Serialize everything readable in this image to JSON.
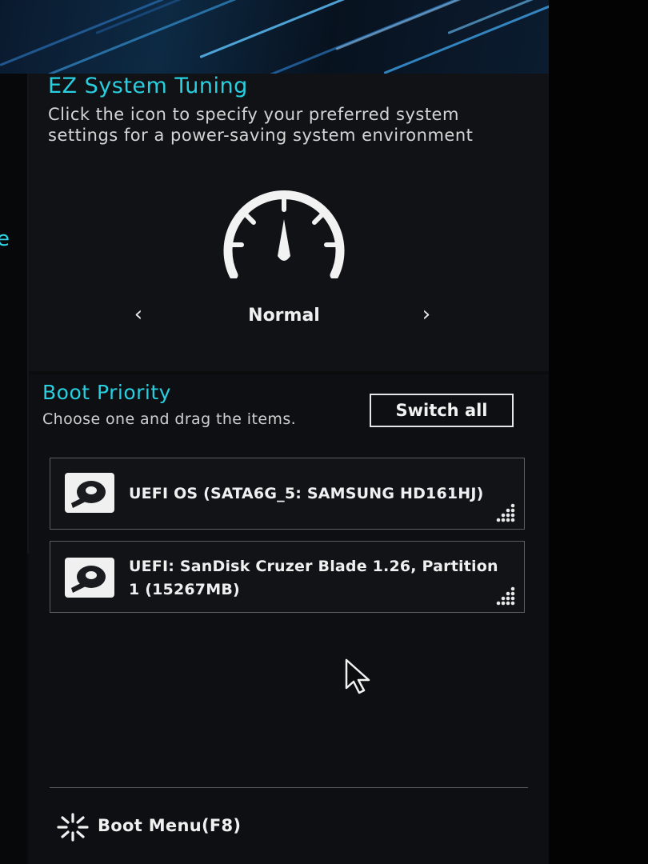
{
  "ez_tuning": {
    "title": "EZ System Tuning",
    "description": "Click the icon to specify your preferred system settings for a power-saving system environment",
    "mode": "Normal",
    "prev_arrow": "‹",
    "next_arrow": "›",
    "gauge_icon": "speedometer-icon"
  },
  "boot_priority": {
    "title": "Boot Priority",
    "description": "Choose one and drag the items.",
    "switch_all_label": "Switch all",
    "items": [
      {
        "line1": "UEFI OS (SATA6G_5: SAMSUNG HD161HJ)",
        "line2": "",
        "icon": "hard-disk-icon"
      },
      {
        "line1": "UEFI: SanDisk Cruzer Blade 1.26, Partition",
        "line2": "1 (15267MB)",
        "icon": "hard-disk-icon"
      }
    ]
  },
  "footer": {
    "boot_menu_label": "Boot Menu(F8)",
    "boot_menu_icon": "burst-icon"
  },
  "left_edge_fragment": "e",
  "colors": {
    "accent": "#27cfe0",
    "background": "#0b0c0e",
    "text": "#f0f0f0"
  }
}
